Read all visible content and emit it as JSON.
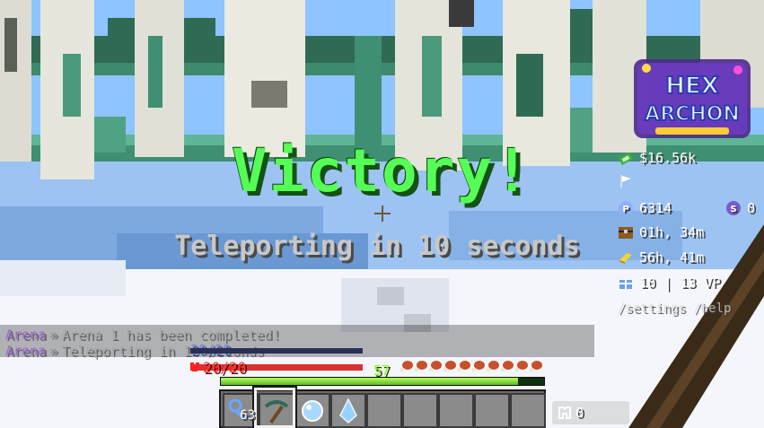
{
  "hud": {
    "title": "Victory!",
    "subtitle": "Teleporting in 10 seconds",
    "health": {
      "current": 20,
      "max": 20,
      "text": "20/20"
    },
    "xp_level": "57",
    "hunger_level": 20,
    "xp_progress": 0.92,
    "hotbar": [
      {
        "item": "blue-key-icon",
        "count": "63"
      },
      {
        "item": "pickaxe-icon",
        "count": ""
      },
      {
        "item": "ice-orb-icon",
        "count": ""
      },
      {
        "item": "ice-shard-icon",
        "count": ""
      },
      {
        "item": "",
        "count": ""
      },
      {
        "item": "",
        "count": ""
      },
      {
        "item": "",
        "count": ""
      },
      {
        "item": "",
        "count": ""
      },
      {
        "item": "",
        "count": ""
      }
    ],
    "selected_slot": 2,
    "offhand": {
      "icon": "armor-icon",
      "value": "0"
    }
  },
  "sidebar": {
    "logo_text": [
      "HEX",
      "ARCHON"
    ],
    "money": "$16.56k",
    "tokens": "6314",
    "shards": "0",
    "playtime_a": "01h, 34m",
    "playtime_b": "56h, 41m",
    "vote_points": "10 | 13 VP",
    "footer": "/settings /help",
    "colors": {
      "money": "#55ff55",
      "token": "#aa88ff",
      "shard": "#8866cc"
    }
  },
  "chat": {
    "lines": [
      {
        "prefix": "Arena",
        "separator": "»",
        "message": "Arena 1 has been completed!"
      },
      {
        "prefix": "Arena",
        "separator": "»",
        "message": "Teleporting in 10 seconds"
      }
    ],
    "overlay_text": "20/20"
  }
}
